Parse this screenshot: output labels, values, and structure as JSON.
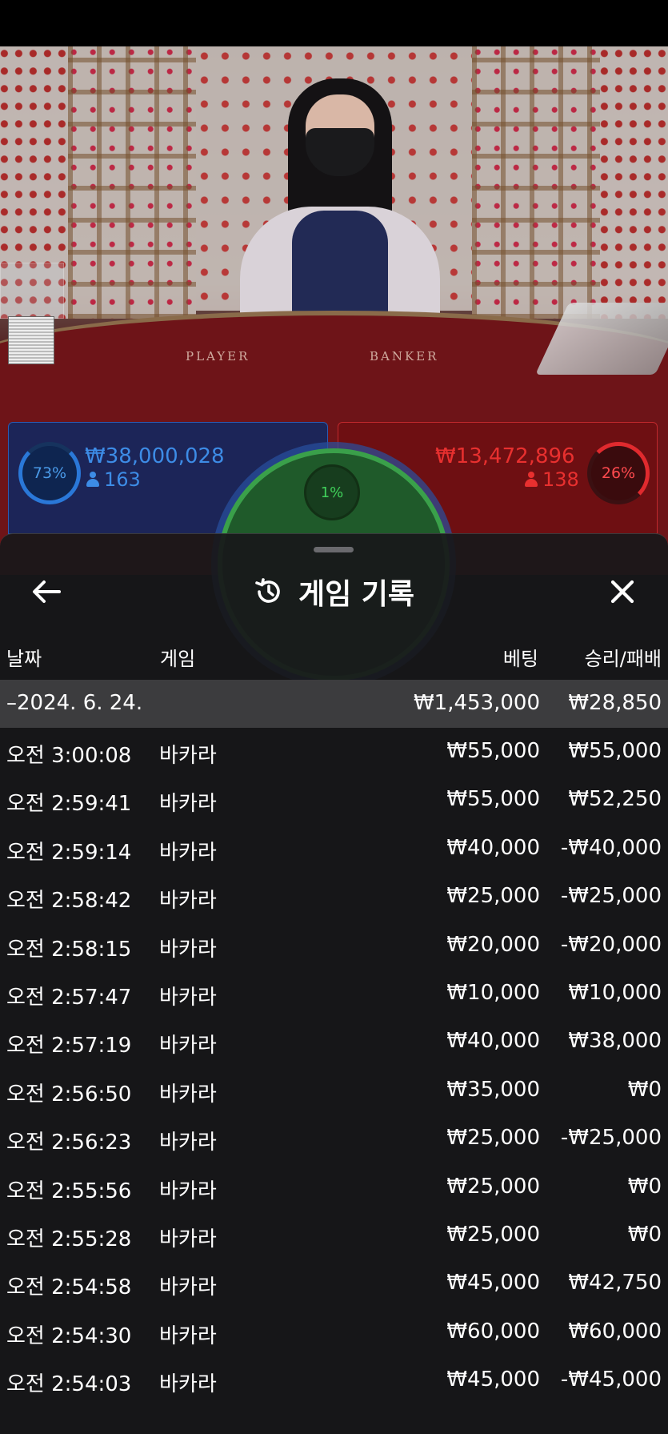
{
  "live": {
    "felt_player": "PLAYER",
    "felt_banker": "BANKER",
    "player": {
      "percent": "73%",
      "amount": "₩38,000,028",
      "count": "163"
    },
    "banker": {
      "percent": "26%",
      "amount": "₩13,472,896",
      "count": "138"
    },
    "tie": {
      "percent": "1%"
    }
  },
  "sheet": {
    "title": "게임 기록",
    "columns": {
      "date": "날짜",
      "game": "게임",
      "bet": "베팅",
      "result": "승리/패배"
    },
    "date_group": {
      "date": "–2024. 6. 24.",
      "bet": "₩1,453,000",
      "result": "₩28,850"
    },
    "rows": [
      {
        "time": "오전 3:00:08",
        "game": "바카라",
        "bet": "₩55,000",
        "result": "₩55,000"
      },
      {
        "time": "오전 2:59:41",
        "game": "바카라",
        "bet": "₩55,000",
        "result": "₩52,250"
      },
      {
        "time": "오전 2:59:14",
        "game": "바카라",
        "bet": "₩40,000",
        "result": "-₩40,000"
      },
      {
        "time": "오전 2:58:42",
        "game": "바카라",
        "bet": "₩25,000",
        "result": "-₩25,000"
      },
      {
        "time": "오전 2:58:15",
        "game": "바카라",
        "bet": "₩20,000",
        "result": "-₩20,000"
      },
      {
        "time": "오전 2:57:47",
        "game": "바카라",
        "bet": "₩10,000",
        "result": "₩10,000"
      },
      {
        "time": "오전 2:57:19",
        "game": "바카라",
        "bet": "₩40,000",
        "result": "₩38,000"
      },
      {
        "time": "오전 2:56:50",
        "game": "바카라",
        "bet": "₩35,000",
        "result": "₩0"
      },
      {
        "time": "오전 2:56:23",
        "game": "바카라",
        "bet": "₩25,000",
        "result": "-₩25,000"
      },
      {
        "time": "오전 2:55:56",
        "game": "바카라",
        "bet": "₩25,000",
        "result": "₩0"
      },
      {
        "time": "오전 2:55:28",
        "game": "바카라",
        "bet": "₩25,000",
        "result": "₩0"
      },
      {
        "time": "오전 2:54:58",
        "game": "바카라",
        "bet": "₩45,000",
        "result": "₩42,750"
      },
      {
        "time": "오전 2:54:30",
        "game": "바카라",
        "bet": "₩60,000",
        "result": "₩60,000"
      },
      {
        "time": "오전 2:54:03",
        "game": "바카라",
        "bet": "₩45,000",
        "result": "-₩45,000"
      }
    ]
  },
  "icons": {
    "back": "arrow-left-icon",
    "history": "history-clock-icon",
    "close": "close-icon",
    "person": "person-icon"
  },
  "colors": {
    "player_blue": "#3d8ce6",
    "banker_red": "#e8302f",
    "tie_green": "#40d05a",
    "sheet_bg": "#18181a",
    "date_row_bg": "#3c3c3e"
  }
}
